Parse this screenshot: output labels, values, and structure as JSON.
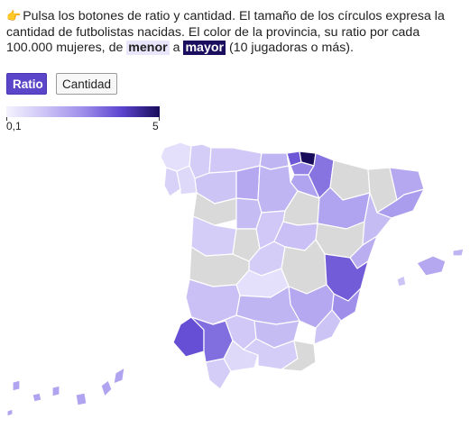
{
  "intro": {
    "icon": "pointing-hand-icon",
    "text_before": "Pulsa los botones de ratio y cantidad. El tamaño de los círculos expresa la cantidad de futbolistas nacidas. El color de la provincia, su ratio por cada 100.000 mujeres, de ",
    "menor": "menor",
    "connector": " a ",
    "mayor": "mayor",
    "text_after": " (10 jugadoras o más)."
  },
  "buttons": {
    "ratio": "Ratio",
    "cantidad": "Cantidad",
    "active": "ratio"
  },
  "legend": {
    "min_label": "0,1",
    "max_label": "5",
    "min": 0.1,
    "max": 5,
    "colors": [
      "#f4f2fe",
      "#cdc4f6",
      "#9e8eea",
      "#5d45d0",
      "#180b5a"
    ]
  },
  "map": {
    "no_data_color": "#d9d9d9",
    "provinces": [
      {
        "id": "a-coruna",
        "ratio": 0.15
      },
      {
        "id": "lugo",
        "ratio": 0.3
      },
      {
        "id": "pontevedra",
        "ratio": 0.25
      },
      {
        "id": "ourense",
        "ratio": 0.2
      },
      {
        "id": "asturias",
        "ratio": 0.35
      },
      {
        "id": "cantabria",
        "ratio": 0.6
      },
      {
        "id": "bizkaia",
        "ratio": 2.4
      },
      {
        "id": "gipuzkoa",
        "ratio": 5.0
      },
      {
        "id": "araba",
        "ratio": 1.5
      },
      {
        "id": "navarra",
        "ratio": 1.8
      },
      {
        "id": "la-rioja",
        "ratio": 0.9
      },
      {
        "id": "leon",
        "ratio": 0.4
      },
      {
        "id": "palencia",
        "ratio": 0.8
      },
      {
        "id": "burgos",
        "ratio": 0.6
      },
      {
        "id": "zamora",
        "ratio": null
      },
      {
        "id": "valladolid",
        "ratio": 0.5
      },
      {
        "id": "soria",
        "ratio": null
      },
      {
        "id": "salamanca",
        "ratio": 0.3
      },
      {
        "id": "avila",
        "ratio": null
      },
      {
        "id": "segovia",
        "ratio": 0.35
      },
      {
        "id": "huesca",
        "ratio": null
      },
      {
        "id": "zaragoza",
        "ratio": 0.9
      },
      {
        "id": "teruel",
        "ratio": null
      },
      {
        "id": "lleida",
        "ratio": null
      },
      {
        "id": "girona",
        "ratio": 0.8
      },
      {
        "id": "barcelona",
        "ratio": 1.0
      },
      {
        "id": "tarragona",
        "ratio": 0.5
      },
      {
        "id": "madrid",
        "ratio": 0.3
      },
      {
        "id": "guadalajara",
        "ratio": 0.45
      },
      {
        "id": "caceres",
        "ratio": null
      },
      {
        "id": "badajoz",
        "ratio": 0.45
      },
      {
        "id": "toledo",
        "ratio": 0.15
      },
      {
        "id": "cuenca",
        "ratio": null
      },
      {
        "id": "ciudad-real",
        "ratio": 0.6
      },
      {
        "id": "albacete",
        "ratio": 0.8
      },
      {
        "id": "castellon",
        "ratio": 0.7
      },
      {
        "id": "valencia",
        "ratio": 2.3
      },
      {
        "id": "alicante",
        "ratio": 1.3
      },
      {
        "id": "murcia",
        "ratio": 0.4
      },
      {
        "id": "huelva",
        "ratio": 2.6
      },
      {
        "id": "sevilla",
        "ratio": 1.9
      },
      {
        "id": "cordoba",
        "ratio": 0.35
      },
      {
        "id": "jaen",
        "ratio": 0.5
      },
      {
        "id": "cadiz",
        "ratio": 0.3
      },
      {
        "id": "malaga",
        "ratio": 0.2
      },
      {
        "id": "granada",
        "ratio": 0.3
      },
      {
        "id": "almeria",
        "ratio": null
      },
      {
        "id": "mallorca",
        "ratio": 0.8
      },
      {
        "id": "menorca",
        "ratio": 0.6
      },
      {
        "id": "ibiza",
        "ratio": 0.4
      },
      {
        "id": "canarias-lp",
        "ratio": 0.9
      },
      {
        "id": "canarias-tf",
        "ratio": 0.9
      }
    ]
  }
}
